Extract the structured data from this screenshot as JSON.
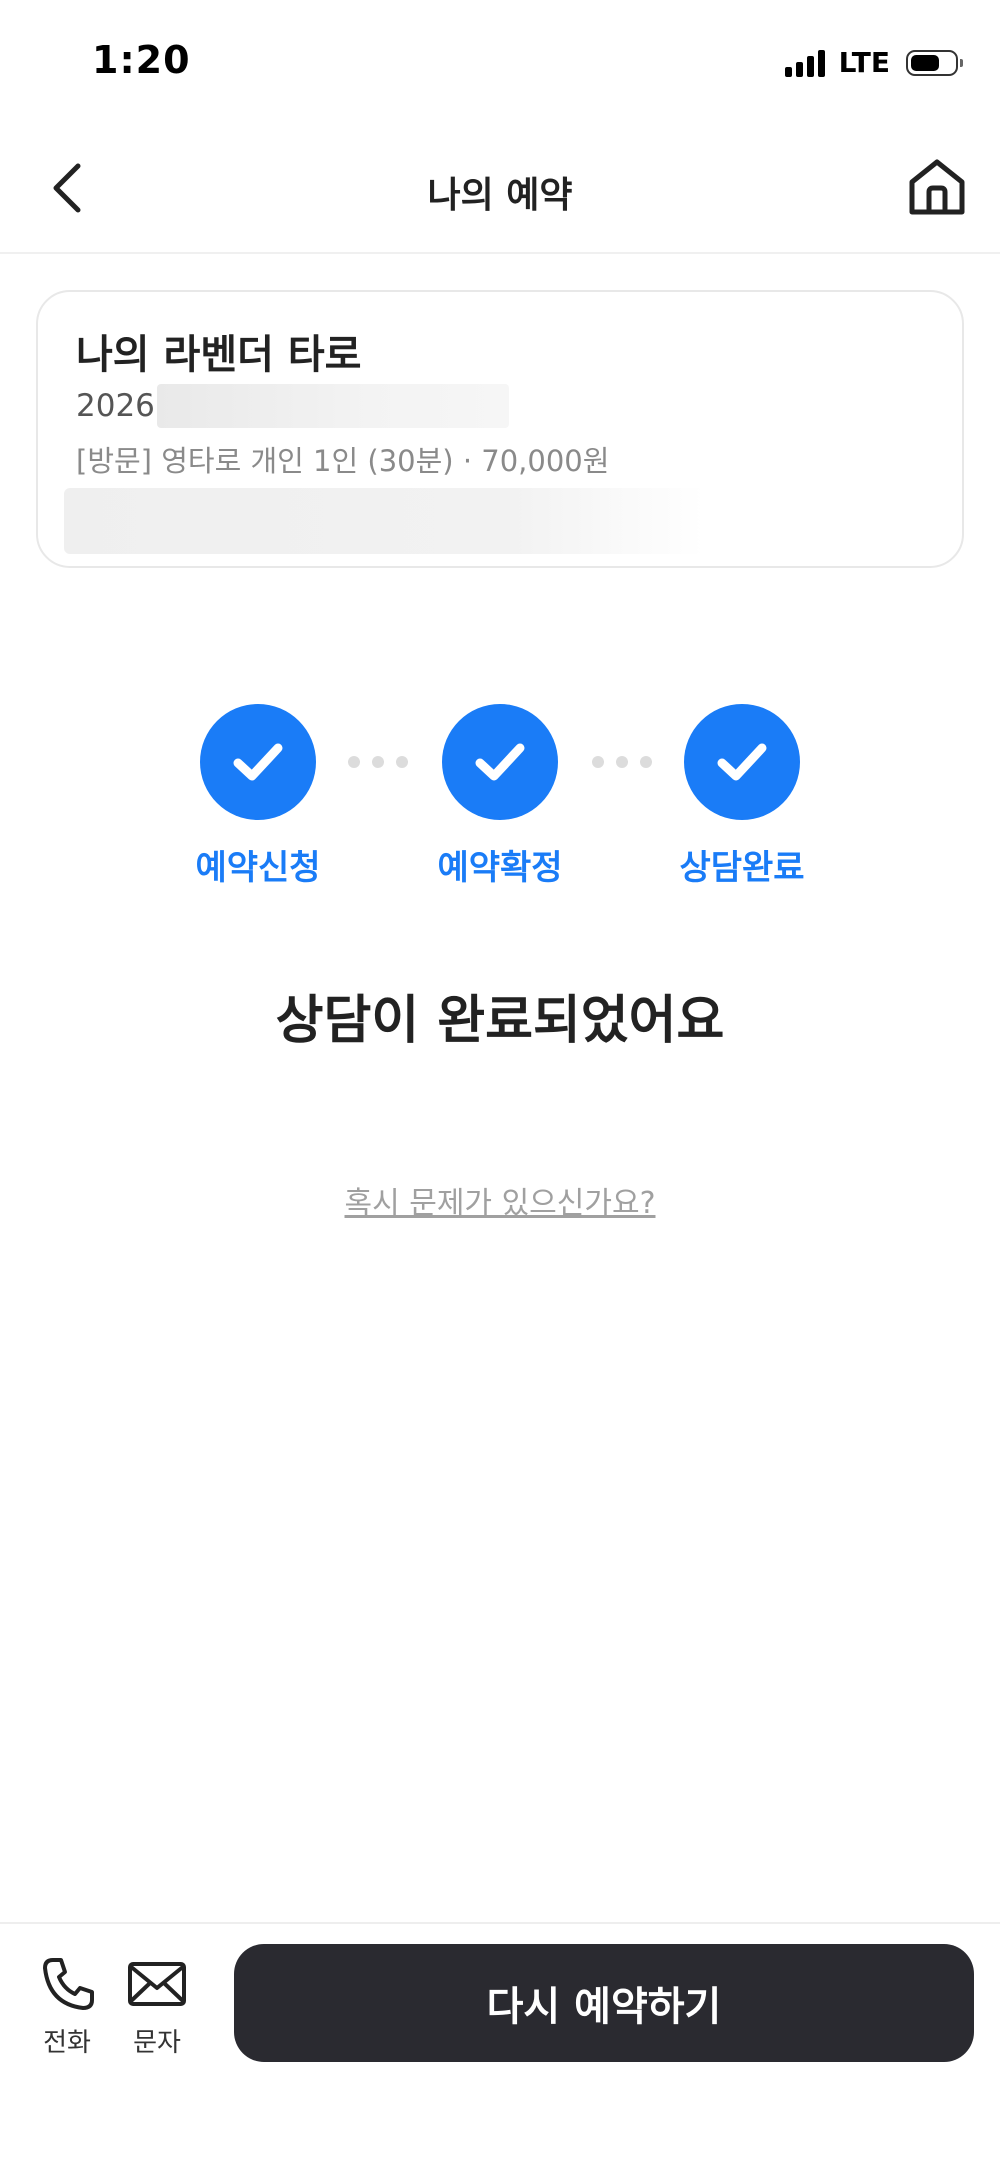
{
  "status_bar": {
    "time": "1:20",
    "network": "LTE"
  },
  "header": {
    "title": "나의 예약"
  },
  "reservation": {
    "store_name": "나의 라벤더 타로",
    "date_prefix": "2026",
    "detail": "[방문] 영타로 개인 1인 (30분) · 70,000원"
  },
  "steps": [
    {
      "label": "예약신청",
      "done": true
    },
    {
      "label": "예약확정",
      "done": true
    },
    {
      "label": "상담완료",
      "done": true
    }
  ],
  "message": {
    "title": "상담이 완료되었어요",
    "help_link": "혹시 문제가 있으신가요?"
  },
  "bottom": {
    "call_label": "전화",
    "message_label": "문자",
    "cta_label": "다시 예약하기"
  },
  "colors": {
    "accent": "#1a7cf7",
    "cta_bg": "#2a2a30"
  }
}
